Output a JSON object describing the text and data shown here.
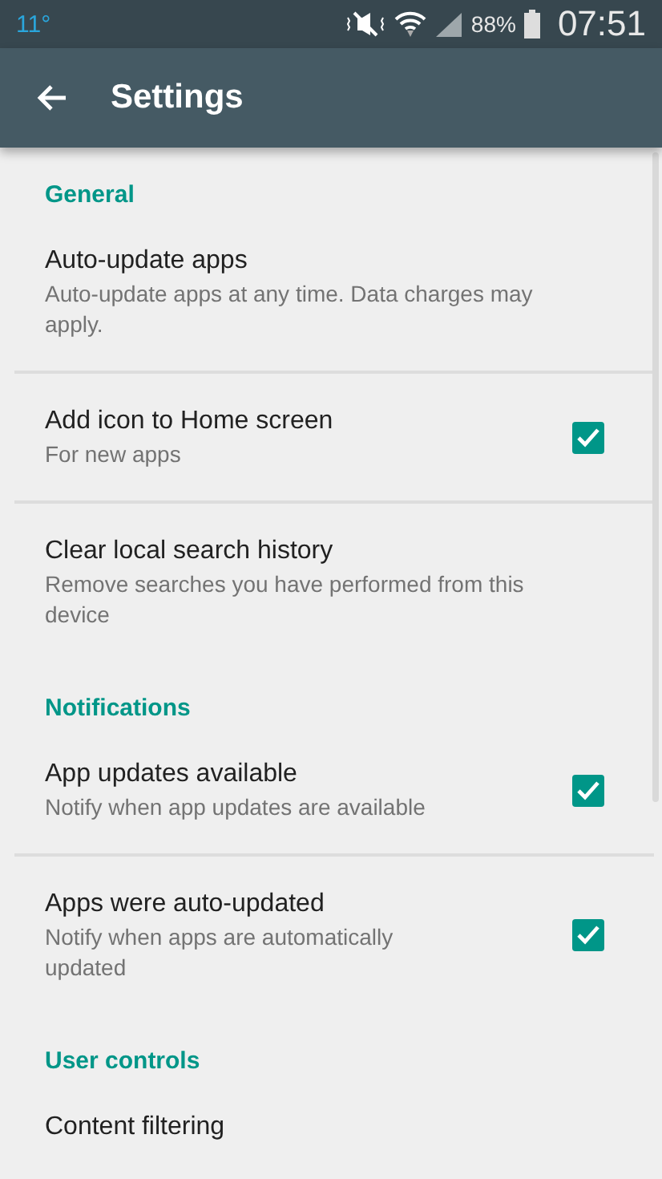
{
  "status_bar": {
    "temperature": "11°",
    "battery": "88%",
    "time": "07:51"
  },
  "app_bar": {
    "title": "Settings"
  },
  "sections": [
    {
      "title": "General",
      "items": [
        {
          "kind": "plain",
          "title": "Auto-update apps",
          "subtitle": "Auto-update apps at any time. Data charges may apply."
        },
        {
          "kind": "checkbox",
          "title": "Add icon to Home screen",
          "subtitle": "For new apps",
          "checked": true
        },
        {
          "kind": "plain",
          "title": "Clear local search history",
          "subtitle": "Remove searches you have performed from this device"
        }
      ]
    },
    {
      "title": "Notifications",
      "items": [
        {
          "kind": "checkbox",
          "title": "App updates available",
          "subtitle": "Notify when app updates are available",
          "checked": true
        },
        {
          "kind": "checkbox",
          "title": "Apps were auto-updated",
          "subtitle": "Notify when apps are automatically updated",
          "checked": true
        }
      ]
    },
    {
      "title": "User controls",
      "items": [
        {
          "kind": "plain",
          "title": "Content filtering"
        }
      ]
    }
  ]
}
